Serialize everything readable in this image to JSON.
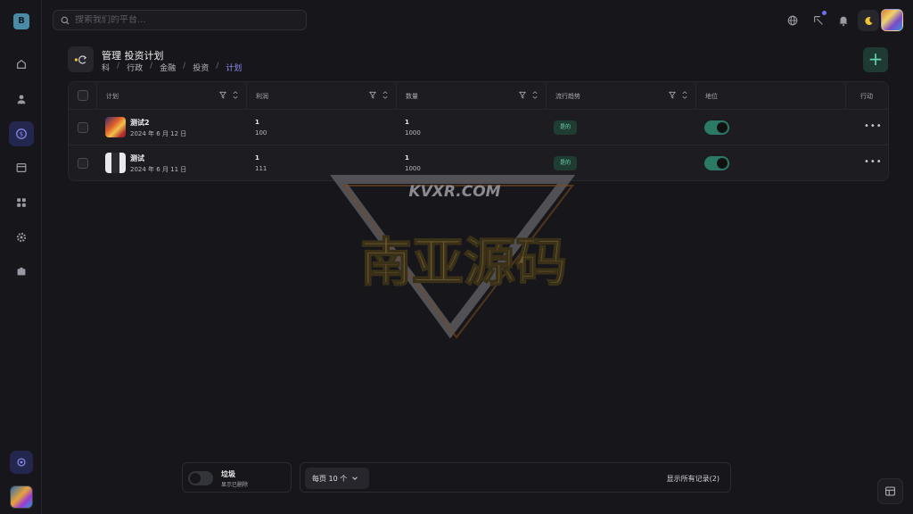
{
  "sidebar": {
    "logo_letter": "B",
    "items": [
      {
        "icon": "home-icon"
      },
      {
        "icon": "user-icon"
      },
      {
        "icon": "dollar-icon",
        "active": true
      },
      {
        "icon": "calendar-icon"
      },
      {
        "icon": "grid-icon"
      },
      {
        "icon": "gear-icon"
      },
      {
        "icon": "puzzle-icon"
      }
    ],
    "bottom_icon": "settings-badge-icon"
  },
  "topbar": {
    "search_placeholder": "搜索我们的平台..."
  },
  "header": {
    "title": "管理 投资计划",
    "breadcrumbs": [
      "科",
      "行政",
      "金融",
      "投资",
      "计划"
    ]
  },
  "table": {
    "columns": [
      "计划",
      "利润",
      "数量",
      "流行趋势",
      "地位",
      "行动"
    ],
    "rows": [
      {
        "name": "测试2",
        "date": "2024 年 6 月 12 日",
        "profit_top": "1",
        "profit_bottom": "100",
        "amount_top": "1",
        "amount_bottom": "1000",
        "trend": "是的",
        "status": "on"
      },
      {
        "name": "测试",
        "date": "2024 年 6 月 11 日",
        "profit_top": "1",
        "profit_bottom": "111",
        "amount_top": "1",
        "amount_bottom": "1000",
        "trend": "是的",
        "status": "on"
      }
    ]
  },
  "watermark": {
    "domain": "KVXR.COM",
    "text": "南亚源码"
  },
  "footer": {
    "trash_title": "垃圾",
    "trash_sub": "显示已删除",
    "per_page": "每页 10 个",
    "records": "显示所有记录(2)"
  },
  "colors": {
    "accent": "#8a8df2",
    "success": "#2b7a66",
    "background": "#17171b"
  }
}
